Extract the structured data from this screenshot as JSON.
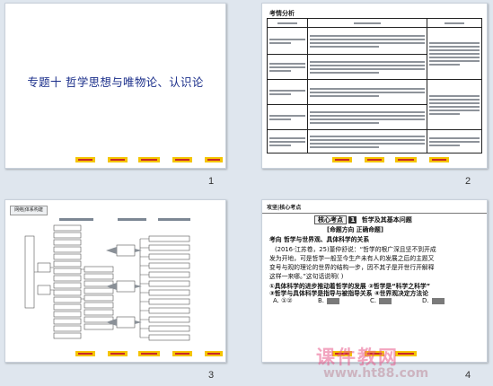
{
  "slides": [
    {
      "number": "1",
      "title": "专题十  哲学思想与唯物论、认识论"
    },
    {
      "number": "2",
      "header": "考情分析",
      "table": {
        "columns": [
          "",
          "",
          ""
        ]
      }
    },
    {
      "number": "3",
      "tab": "网络|体系构建"
    },
    {
      "number": "4",
      "header": "攻坚|核心考点",
      "kp_label": "核心考点",
      "kp_num": "1",
      "kp_title": "哲学及其基本问题",
      "section": "[命题方向   正确命题]",
      "lines": [
        "考向  哲学与世界观、具体科学的关系",
        "(2016·江苏卷，25)董仲舒说：“哲学的根广深且坚不到开成",
        "发为开地，可是哲学一般至今生产未有人的发展之后的主题又",
        "变号与观的理论的世界的结构一步，因不其子是开世行开解释",
        "这样一来哪。”这句话说明(     )",
        "①具体科学的进步推动着哲学的发展  ②哲学是“科学之科学”",
        "③哲学与具体科学是指导与被指导关系  ④世界观决定方法论"
      ],
      "options": [
        "A. ①②",
        "B.",
        "C.",
        "D."
      ]
    }
  ],
  "watermark": {
    "brand": "课件教网",
    "url": "www.ht88.com"
  }
}
